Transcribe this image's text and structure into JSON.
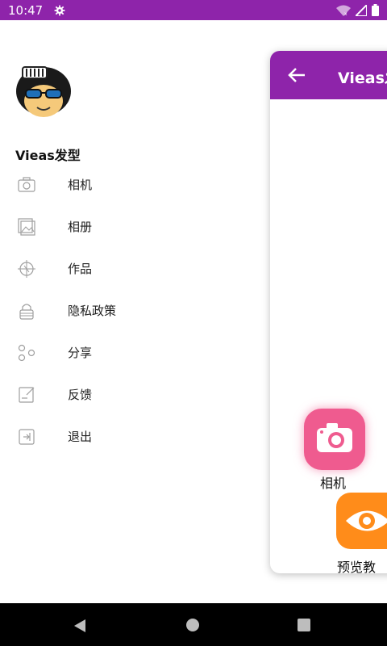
{
  "status_bar": {
    "time": "10:47"
  },
  "drawer": {
    "app_name": "Vieas发型",
    "menu": [
      {
        "label": "相机",
        "icon": "camera-icon"
      },
      {
        "label": "相册",
        "icon": "album-icon"
      },
      {
        "label": "作品",
        "icon": "works-icon"
      },
      {
        "label": "隐私政策",
        "icon": "lock-icon"
      },
      {
        "label": "分享",
        "icon": "share-icon"
      },
      {
        "label": "反馈",
        "icon": "feedback-icon"
      },
      {
        "label": "退出",
        "icon": "exit-icon"
      }
    ]
  },
  "main": {
    "title": "Vieas发",
    "features": [
      {
        "label": "相机",
        "icon": "camera-icon",
        "color": "#ef5b8f"
      },
      {
        "label": "预览教",
        "icon": "eye-icon",
        "color": "#ff8c1a"
      }
    ]
  },
  "colors": {
    "primary": "#8e24aa"
  }
}
